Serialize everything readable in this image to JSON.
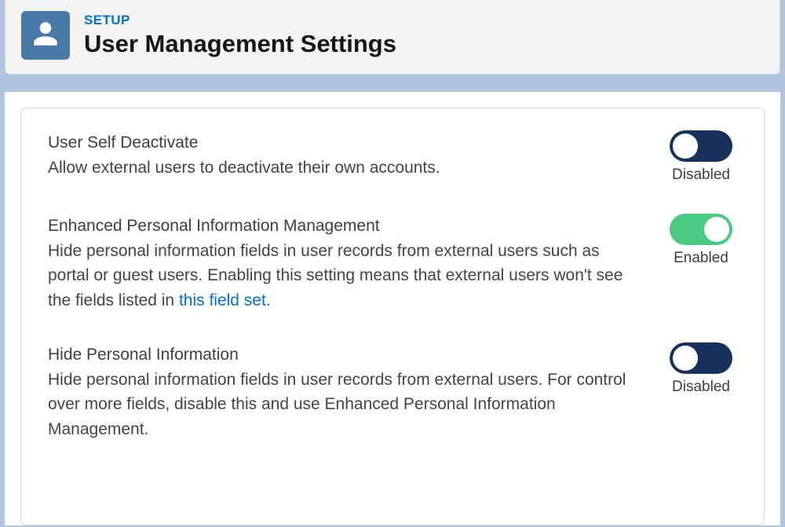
{
  "header": {
    "setup_label": "SETUP",
    "page_title": "User Management Settings"
  },
  "settings": [
    {
      "title": "User Self Deactivate",
      "description_parts": [
        {
          "text": "Allow external users to deactivate their own accounts.",
          "link": false
        }
      ],
      "enabled": false,
      "state_label": "Disabled"
    },
    {
      "title": "Enhanced Personal Information Management",
      "description_parts": [
        {
          "text": "Hide personal information fields in user records from external users such as portal or guest users. Enabling this setting means that external users won't see the fields listed in ",
          "link": false
        },
        {
          "text": "this field set.",
          "link": true
        }
      ],
      "enabled": true,
      "state_label": "Enabled"
    },
    {
      "title": "Hide Personal Information",
      "description_parts": [
        {
          "text": "Hide personal information fields in user records from external users. For control over more fields, disable this and use Enhanced Personal Information Management.",
          "link": false
        }
      ],
      "enabled": false,
      "state_label": "Disabled"
    }
  ]
}
